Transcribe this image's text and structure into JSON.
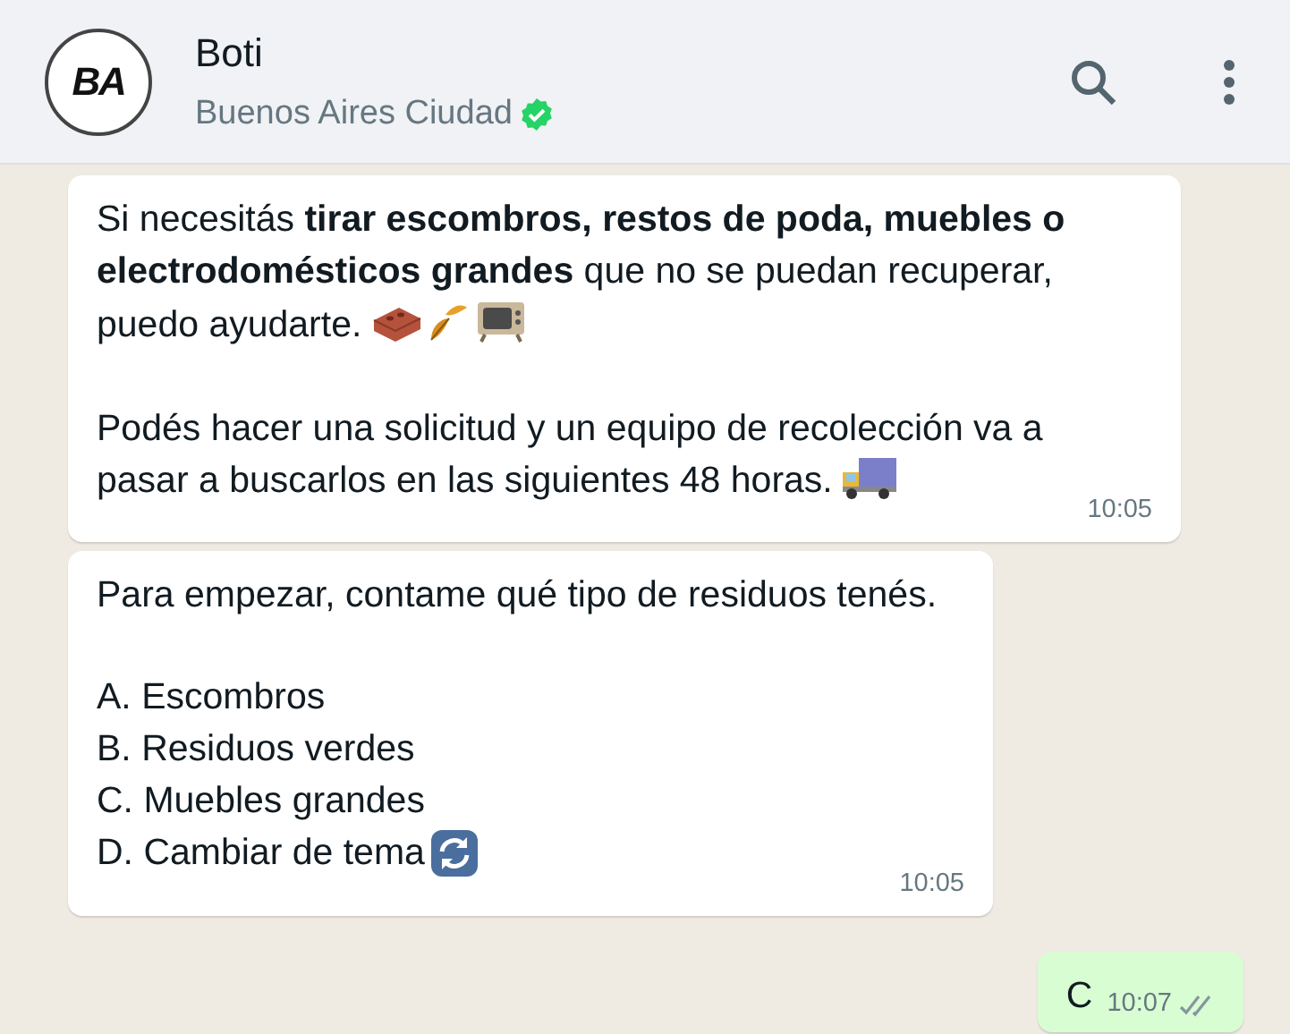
{
  "header": {
    "logo_text": "BA",
    "name": "Boti",
    "subtitle": "Buenos Aires Ciudad",
    "verified": true
  },
  "messages": [
    {
      "kind": "incoming",
      "blocks": [
        {
          "kind": "text",
          "text": "Si necesitás **tirar escombros, restos de poda, muebles o electrodomésticos grandes** que no se puedan recuperar, puedo ayudarte."
        },
        {
          "kind": "text",
          "text": "Podés hacer una solicitud y un equipo de recolección va a pasar a buscarlos en las siguientes 48 horas."
        }
      ],
      "time": "10:05"
    },
    {
      "kind": "incoming",
      "blocks": [
        {
          "kind": "text",
          "text": "Para empezar, contame qué tipo de residuos tenés."
        },
        {
          "kind": "list",
          "items": [
            "A. Escombros",
            "B. Residuos verdes",
            "C. Muebles grandes",
            "D. Cambiar de tema"
          ]
        }
      ],
      "time": "10:05"
    },
    {
      "kind": "outgoing",
      "blocks": [
        {
          "kind": "text",
          "text": "C"
        }
      ],
      "time": "10:07",
      "read": false
    }
  ]
}
